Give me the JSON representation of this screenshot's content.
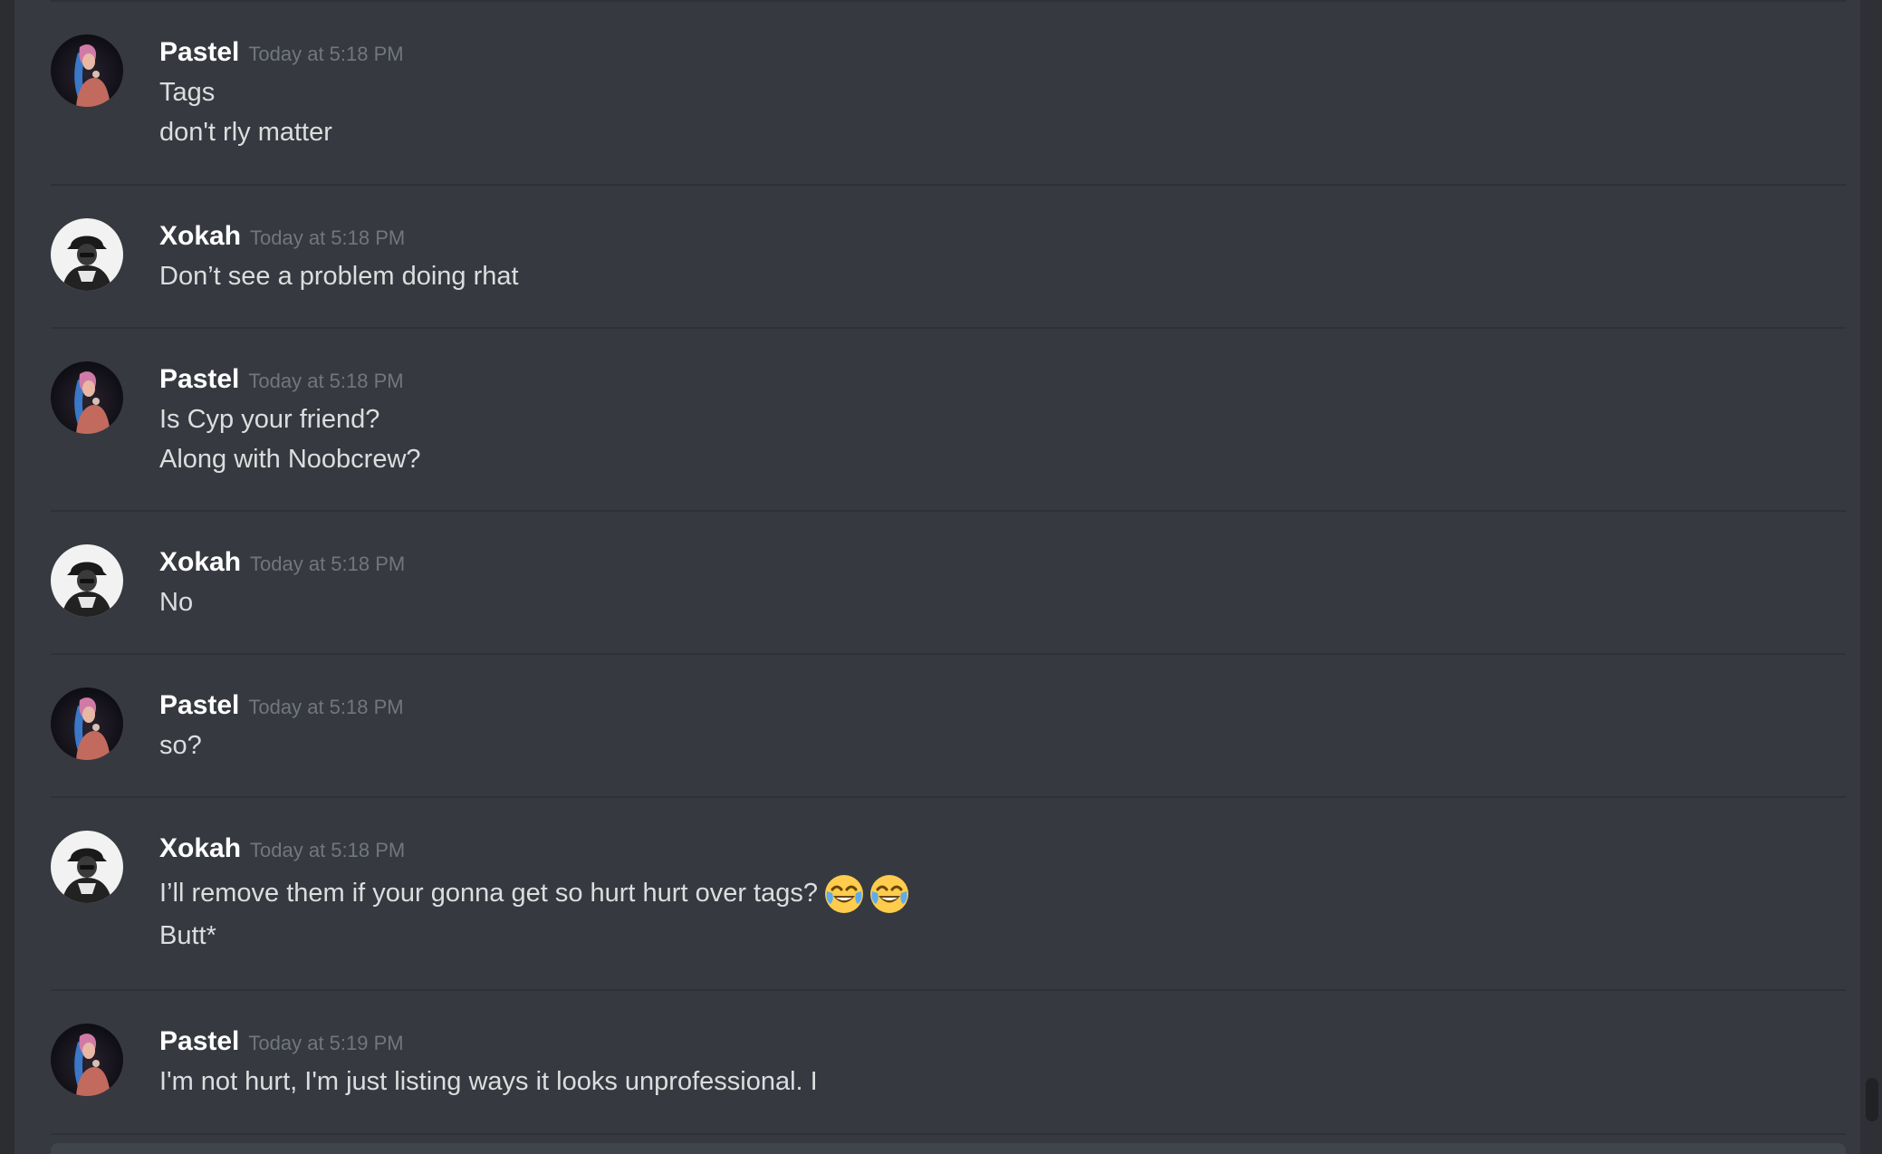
{
  "theme": {
    "background": "#36393f",
    "username_color": "#ffffff",
    "timestamp_color": "#72767d",
    "text_color": "#dcddde"
  },
  "icons": {
    "pastel_avatar": "pastel-avatar-icon",
    "xokah_avatar": "xokah-avatar-icon",
    "emoji": "joy-emoji-icon"
  },
  "messages": [
    {
      "author": "Pastel",
      "timestamp": "Today at 5:18 PM",
      "lines": [
        "Tags",
        "don't rly matter"
      ]
    },
    {
      "author": "Xokah",
      "timestamp": "Today at 5:18 PM",
      "lines": [
        "Don’t see a problem doing rhat"
      ]
    },
    {
      "author": "Pastel",
      "timestamp": "Today at 5:18 PM",
      "lines": [
        "Is Cyp your friend?",
        "Along with Noobcrew?"
      ]
    },
    {
      "author": "Xokah",
      "timestamp": "Today at 5:18 PM",
      "lines": [
        "No"
      ]
    },
    {
      "author": "Pastel",
      "timestamp": "Today at 5:18 PM",
      "lines": [
        "so?"
      ]
    },
    {
      "author": "Xokah",
      "timestamp": "Today at 5:18 PM",
      "lines": [
        "I’ll remove them if your gonna get so hurt hurt over tags?",
        "Butt*"
      ]
    },
    {
      "author": "Pastel",
      "timestamp": "Today at 5:19 PM",
      "lines": [
        "I'm not hurt, I'm just listing ways it looks unprofessional. I"
      ]
    }
  ]
}
